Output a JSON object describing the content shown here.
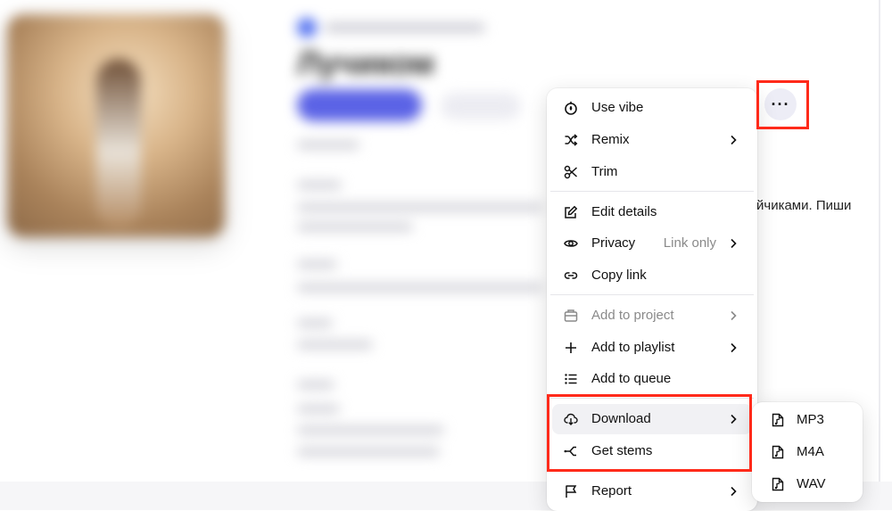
{
  "background": {
    "song_title": "Лучиком",
    "partial_text": "йчиками. Пиши"
  },
  "more_button": {
    "label": "···"
  },
  "menu": {
    "items": [
      {
        "label": "Use vibe",
        "icon": "vibe-icon"
      },
      {
        "label": "Remix",
        "icon": "shuffle-icon",
        "has_submenu": true
      },
      {
        "label": "Trim",
        "icon": "scissors-icon"
      },
      {
        "label": "Edit details",
        "icon": "edit-icon"
      },
      {
        "label": "Privacy",
        "icon": "eye-icon",
        "value": "Link only",
        "has_submenu": true
      },
      {
        "label": "Copy link",
        "icon": "link-icon"
      },
      {
        "label": "Add to project",
        "icon": "project-icon",
        "has_submenu": true,
        "disabled": true
      },
      {
        "label": "Add to playlist",
        "icon": "plus-icon",
        "has_submenu": true
      },
      {
        "label": "Add to queue",
        "icon": "list-icon"
      },
      {
        "label": "Download",
        "icon": "cloud-download-icon",
        "has_submenu": true,
        "active": true
      },
      {
        "label": "Get stems",
        "icon": "stems-icon"
      },
      {
        "label": "Report",
        "icon": "flag-icon",
        "has_submenu": true
      }
    ]
  },
  "download_submenu": {
    "items": [
      {
        "label": "MP3",
        "icon": "file-audio-icon"
      },
      {
        "label": "M4A",
        "icon": "file-audio-icon"
      },
      {
        "label": "WAV",
        "icon": "file-audio-icon"
      }
    ]
  },
  "colors": {
    "highlight": "#ff2a1a",
    "primary": "#5b63e6",
    "menu_bg": "#ffffff",
    "muted_text": "#8a8a8a"
  }
}
